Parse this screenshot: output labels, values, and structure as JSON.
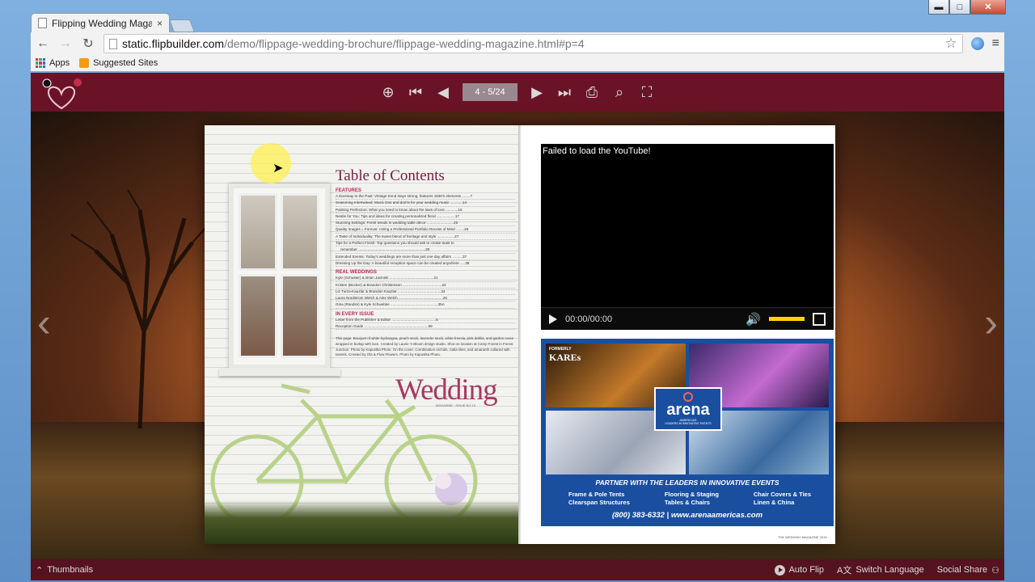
{
  "browser": {
    "tab_title": "Flipping Wedding Magazin",
    "tab_close": "×",
    "url_host": "static.flipbuilder.com",
    "url_path": "/demo/flippage-wedding-brochure/flippage-wedding-magazine.html#p=4",
    "bookmarks": [
      "Apps",
      "Suggested Sites"
    ],
    "win_min": "▬",
    "win_max": "□",
    "win_close": "✕"
  },
  "flipbook": {
    "page_indicator": "4 - 5/24",
    "left_page": {
      "toc_title": "Table of Contents",
      "sections": [
        {
          "heading": "FEATURES",
          "lines": [
            "A Doorway to the Past: Vintage trend stays strong, features 1930's elements ........7",
            "Seasoning Intertwined: Music Dos and don'ts for your wedding music ............14",
            "Painting Perfection: What you need to know about the laws of love ............15",
            "Nestle for You: Tips and ideas for creating personalized floral ..................17",
            "Stunning Settings: Fresh trends in wedding table décor ..........................25",
            "Quality Images = Forever: Hiring a Professional Portfolio Recess of Mind ........26",
            "A Taste of Individuality: The sweet blend of heritage and style .................27",
            "Tips for a Perfect Finish: Top questions you should ask to create toast to",
            "remember .................................................................30",
            "Extended Events: Today's weddings are more than just one day affairs ..........37",
            "Dressing Up the Day: A beautiful reception space can be created anywhere .....38"
          ]
        },
        {
          "heading": "REAL WEDDINGS",
          "lines": [
            "Kyle (Schuster) & Brian Jacinski ...........................................21",
            "Kristen (Becker) & Brandon Christensen ......................................22",
            "Liz Turza-Kauzlar & Brandon Kauzlar ..........................................24",
            "Laura Nordstrom Welch & Alex Welch ...........................................25",
            "Gina (Randini) & Kyle Schwebke ..............................................35A"
          ]
        },
        {
          "heading": "IN EVERY ISSUE",
          "lines": [
            "Letter from the Publisher & Editor ...........................................6",
            "Reception Guide ..............................................................59"
          ]
        }
      ],
      "note": "This page: Bouquet of white hydrangea, peach stock, lavender stock, white freesia, pink dahlia, and garden roses wrapped in burlap with lace. Created by Laurie 'n Bloom design studio. Shot on location at Camp Forest in Forest Junction. Photo by Kapustka Photo. On the cover: Combination orchids, Calla lilies, and amaranth collared with tassels. Created by Ola & Flow Flowers. Photo by Kapustka Photo.",
      "wedding_word": "Wedding",
      "wedding_sub": "MAGAZINE · ISSUE NO 10"
    },
    "right_page": {
      "video_error": "Failed to load the YouTube!",
      "video_time": "00:00/00:00",
      "ad_formerly": "FORMERLY",
      "ad_kares": "KAREs",
      "ad_brand": "arena",
      "ad_brand_sub": "AMERICAS",
      "ad_brand_sub2": "LEADERS IN INNOVATIVE EVENTS",
      "ad_tagline": "PARTNER WITH THE LEADERS IN INNOVATIVE EVENTS",
      "ad_columns": [
        [
          "Frame & Pole Tents",
          "Clearspan Structures"
        ],
        [
          "Flooring & Staging",
          "Tables & Chairs"
        ],
        [
          "Chair Covers & Ties",
          "Linen & China"
        ]
      ],
      "ad_phone": "(800) 383-6332  |  www.arenaamericas.com",
      "footer": "THE WEDDING MAGAZINE 2015 ·"
    },
    "bottom_bar": {
      "thumbnails": "Thumbnails",
      "auto_flip": "Auto Flip",
      "switch_language": "Switch Language",
      "social_share": "Social Share"
    },
    "colors": {
      "topbar": "#6a1327",
      "bottombar": "#55121f",
      "ad_blue": "#1a4fa0",
      "toc_accent": "#b7285c"
    }
  }
}
